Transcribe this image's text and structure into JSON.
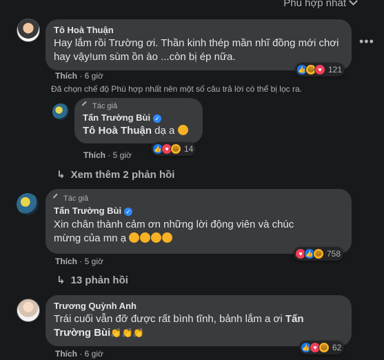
{
  "sort": {
    "label": "Phù hợp nhất"
  },
  "comments": [
    {
      "author": "Tô Hoà Thuận",
      "text": "Hay lắm rồi Trường ơi. Thần kinh thép mần nhĩ đồng mới chơi hay vậy!um sùm ồn ào ...còn bị ép nữa.",
      "like_label": "Thích",
      "time": "6 giờ",
      "reaction_count": "121",
      "filter_note": "Đã chọn chế độ Phù hợp nhất nên một số câu trả lời có thể bị lọc ra.",
      "reply": {
        "author_tag": "Tác giả",
        "author": "Tấn Trường Bùi",
        "mention": "Tô Hoà Thuận",
        "text": "dạ a",
        "like_label": "Thích",
        "time": "5 giờ",
        "reaction_count": "14"
      },
      "more_replies": "Xem thêm 2 phản hồi"
    },
    {
      "author_tag": "Tác giả",
      "author": "Tấn Trường Bùi",
      "text": "Xin chân thành cảm ơn những lời động viên và chúc mừng của mn ạ",
      "like_label": "Thích",
      "time": "5 giờ",
      "reaction_count": "758",
      "more_replies": "13 phản hồi"
    },
    {
      "author": "Trương Quỳnh Anh",
      "text": "Trái cuối vẫn đỡ được rất bình tĩnh, bảnh lắm a ơi",
      "mention": "Tấn Trường Bùi",
      "like_label": "Thích",
      "time": "6 giờ",
      "reaction_count": "62"
    }
  ],
  "icons": {
    "more": "more-options-icon",
    "reactions": [
      "like",
      "haha",
      "love"
    ],
    "verified": "verified-badge-icon"
  }
}
